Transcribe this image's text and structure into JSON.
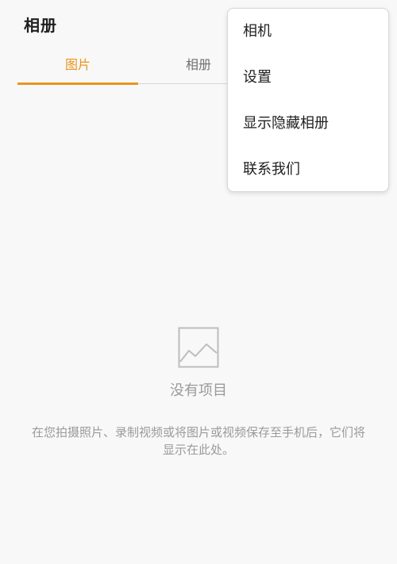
{
  "header": {
    "title": "相册"
  },
  "tabs": [
    {
      "label": "图片",
      "active": true
    },
    {
      "label": "相册",
      "active": false
    },
    {
      "label": "",
      "active": false
    }
  ],
  "menu": {
    "items": [
      {
        "label": "相机"
      },
      {
        "label": "设置"
      },
      {
        "label": "显示隐藏相册"
      },
      {
        "label": "联系我们"
      }
    ]
  },
  "empty_state": {
    "icon": "image-icon",
    "title": "没有项目",
    "description": "在您拍摄照片、录制视频或将图片或视频保存至手机后，它们将显示在此处。"
  },
  "colors": {
    "accent": "#e8951f",
    "background": "#f8f8f8",
    "muted_text": "#9a9a9a"
  }
}
